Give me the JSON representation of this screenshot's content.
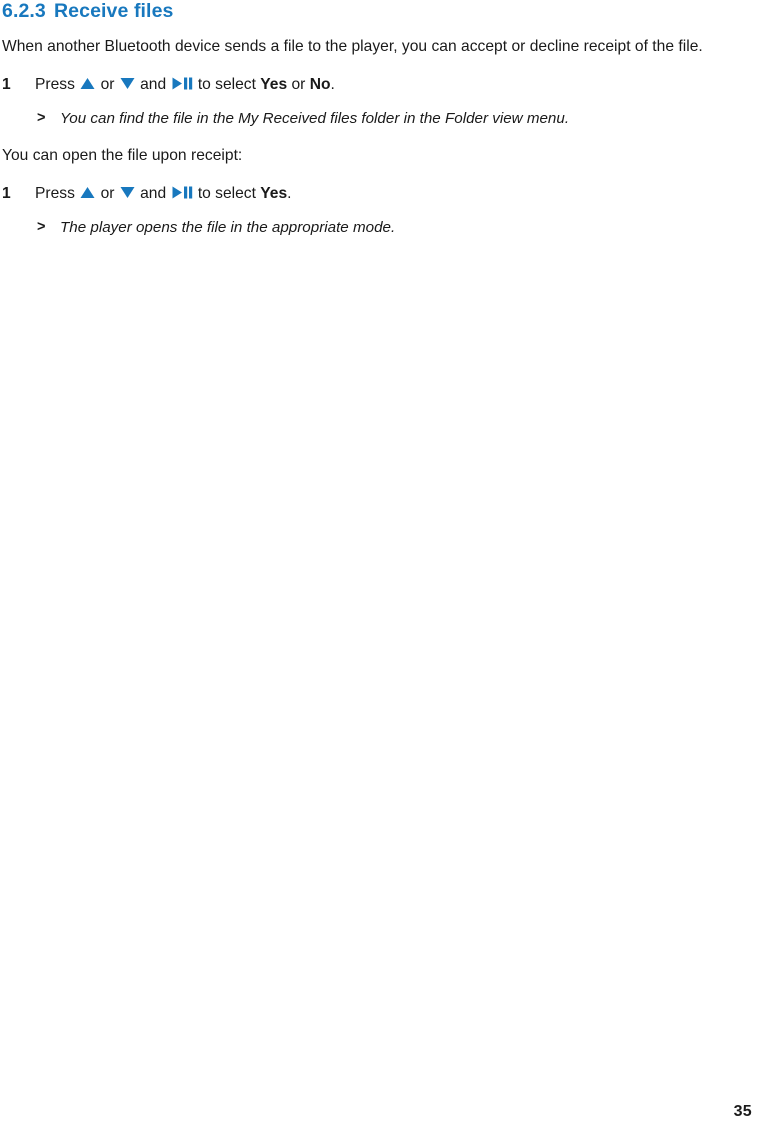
{
  "document": {
    "page_number": "35",
    "accent_color": "#1878be",
    "text_color": "#1a1a1a",
    "background_color": "#ffffff"
  },
  "heading": {
    "number": "6.2.3",
    "title": "Receive files"
  },
  "intro_paragraph": "When another Bluetooth device sends a file to the player, you can accept or decline receipt of the file.",
  "steps": [
    {
      "number": "1",
      "text_before_icons": "Press",
      "icon_up": "up-triangle-icon",
      "text_or": "or",
      "icon_down": "down-triangle-icon",
      "text_and": "and",
      "icon_playpause": "play-pause-icon",
      "text_after_icons": "to select",
      "option_1": "Yes",
      "text_between_options": "or",
      "option_2": "No",
      "text_end": "."
    },
    {
      "number": "1",
      "text_before_icons": "Press",
      "icon_up": "up-triangle-icon",
      "text_or": "or",
      "icon_down": "down-triangle-icon",
      "text_and": "and",
      "icon_playpause": "play-pause-icon",
      "text_after_icons": "to select",
      "option_1": "Yes",
      "text_end": "."
    }
  ],
  "notes": [
    {
      "marker": ">",
      "text": "You can find the file in the My Received files folder in the Folder view menu."
    },
    {
      "marker": ">",
      "text": "The player opens the file in the appropriate mode."
    }
  ],
  "mid_paragraph": "You can open the file upon receipt:"
}
